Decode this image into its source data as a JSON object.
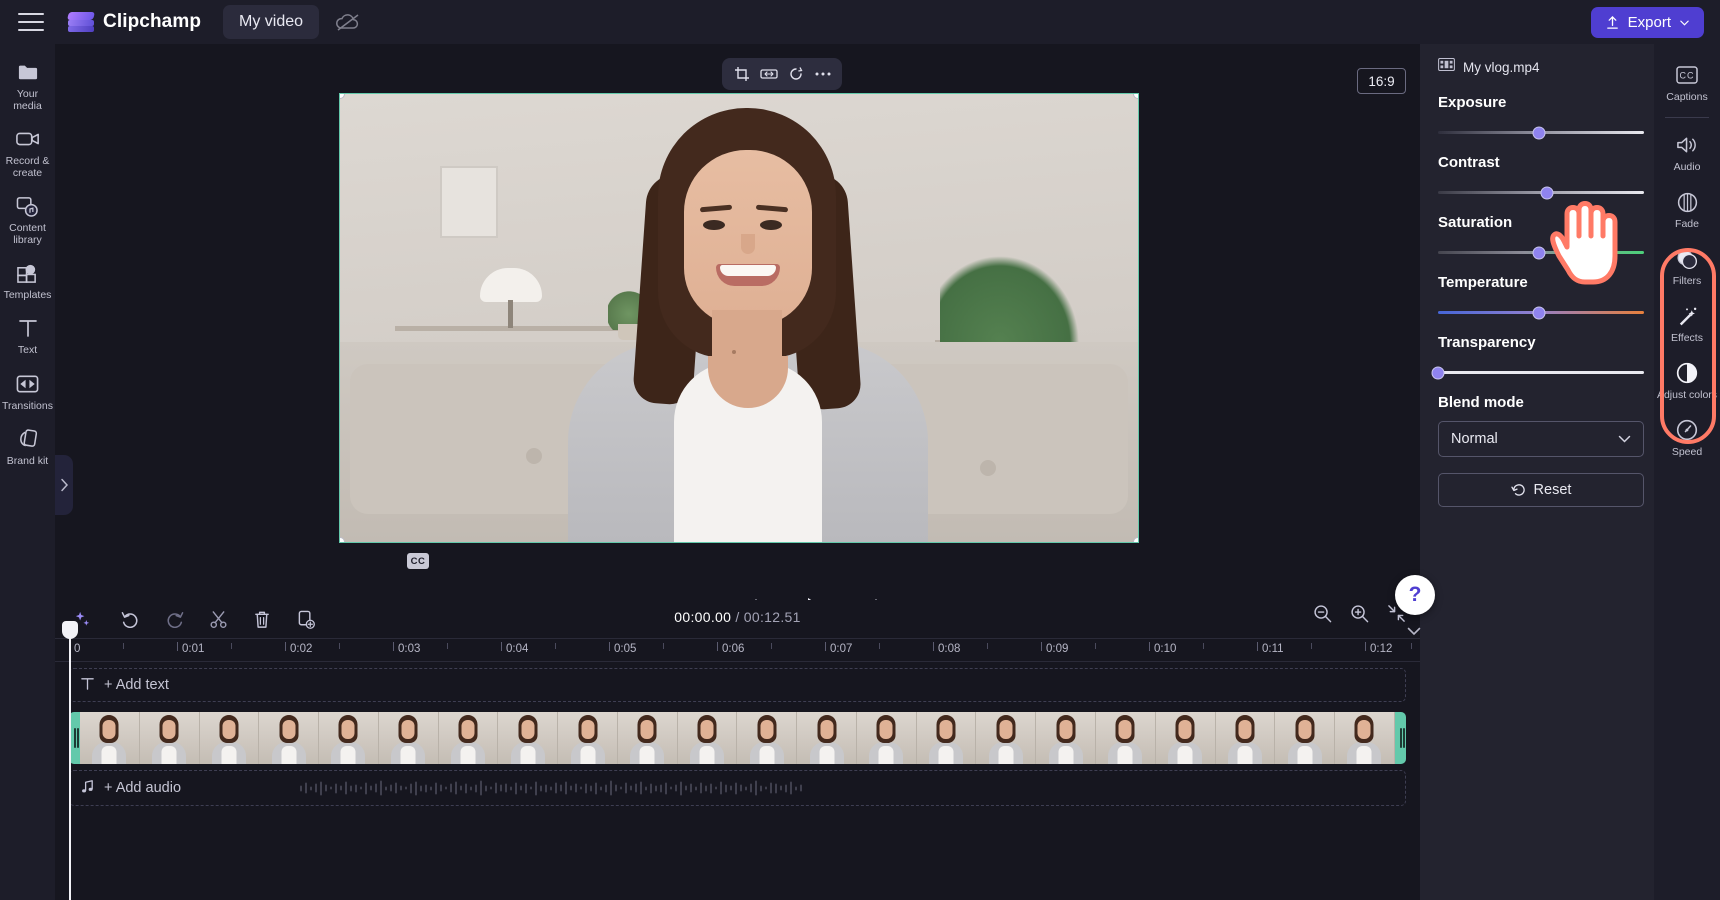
{
  "app": {
    "brand": "Clipchamp",
    "project_name": "My video",
    "menu_icon": "hamburger-icon",
    "cloud_icon": "cloud-offline-icon",
    "export_label": "Export",
    "export_icon": "upload-icon",
    "export_caret": "chevron-down-icon",
    "accent": "#4f3ed1"
  },
  "left_rail": {
    "items": [
      {
        "label": "Your media",
        "icon": "folder-icon"
      },
      {
        "label": "Record & create",
        "icon": "video-camera-icon"
      },
      {
        "label": "Content library",
        "icon": "content-library-icon"
      },
      {
        "label": "Templates",
        "icon": "templates-icon"
      },
      {
        "label": "Text",
        "icon": "text-icon"
      },
      {
        "label": "Transitions",
        "icon": "transitions-icon"
      },
      {
        "label": "Brand kit",
        "icon": "brand-kit-icon"
      }
    ],
    "collapse_icon": "chevron-right-icon"
  },
  "stage": {
    "float_tools": [
      {
        "name": "crop-icon"
      },
      {
        "name": "fit-width-icon"
      },
      {
        "name": "rotate-icon"
      },
      {
        "name": "more-options-icon"
      }
    ],
    "aspect_ratio": "16:9",
    "cc_badge": "CC",
    "player": [
      {
        "name": "skip-to-start-button",
        "icon": "skip-start-icon"
      },
      {
        "name": "rewind-5-button",
        "icon": "back-5-icon"
      },
      {
        "name": "play-button",
        "icon": "play-icon"
      },
      {
        "name": "forward-5-button",
        "icon": "forward-5-icon"
      },
      {
        "name": "skip-to-end-button",
        "icon": "skip-end-icon"
      }
    ],
    "fullscreen_icon": "fullscreen-icon",
    "help_label": "?",
    "help_caret": "chevron-down-icon"
  },
  "properties": {
    "clip_name": "My vlog.mp4",
    "clip_icon": "film-strip-icon",
    "sliders": [
      {
        "label": "Exposure",
        "value_pct": 49,
        "track": "tr-exposure"
      },
      {
        "label": "Contrast",
        "value_pct": 53,
        "track": "tr-contrast"
      },
      {
        "label": "Saturation",
        "value_pct": 49,
        "track": "tr-saturation"
      },
      {
        "label": "Temperature",
        "value_pct": 49,
        "track": "tr-temperature"
      },
      {
        "label": "Transparency",
        "value_pct": 0,
        "track": "tr-transparency"
      }
    ],
    "blend_mode_label": "Blend mode",
    "blend_mode_value": "Normal",
    "blend_caret": "chevron-down-icon",
    "reset_label": "Reset",
    "reset_icon": "undo-icon"
  },
  "right_rail": {
    "items": [
      {
        "label": "Captions",
        "icon": "captions-icon"
      },
      {
        "label": "Audio",
        "icon": "speaker-icon"
      },
      {
        "label": "Fade",
        "icon": "fade-icon"
      },
      {
        "label": "Filters",
        "icon": "filters-icon"
      },
      {
        "label": "Effects",
        "icon": "effects-wand-icon"
      },
      {
        "label": "Adjust colors",
        "icon": "adjust-colors-icon"
      },
      {
        "label": "Speed",
        "icon": "speedometer-icon"
      }
    ],
    "highlight_color": "#ff7a66"
  },
  "timeline": {
    "tools": [
      {
        "name": "magic-ai-button",
        "icon": "sparkle-icon"
      },
      {
        "name": "undo-button",
        "icon": "undo-icon"
      },
      {
        "name": "redo-button",
        "icon": "redo-icon"
      },
      {
        "name": "split-button",
        "icon": "scissors-icon"
      },
      {
        "name": "delete-button",
        "icon": "trash-icon"
      },
      {
        "name": "duplicate-button",
        "icon": "duplicate-icon"
      }
    ],
    "current_time": "00:00.00",
    "separator": " / ",
    "total_time": "00:12.51",
    "zoom_controls": [
      {
        "name": "zoom-out-button",
        "icon": "zoom-out-icon"
      },
      {
        "name": "zoom-in-button",
        "icon": "zoom-in-icon"
      },
      {
        "name": "fit-timeline-button",
        "icon": "fit-icon"
      }
    ],
    "ruler_labels": [
      "0",
      "0:01",
      "0:02",
      "0:03",
      "0:04",
      "0:05",
      "0:06",
      "0:07",
      "0:08",
      "0:09",
      "0:10",
      "0:11",
      "0:12"
    ],
    "add_text_label": "+ Add text",
    "add_text_icon": "text-icon",
    "add_audio_label": "+ Add audio",
    "add_audio_icon": "music-note-icon"
  }
}
